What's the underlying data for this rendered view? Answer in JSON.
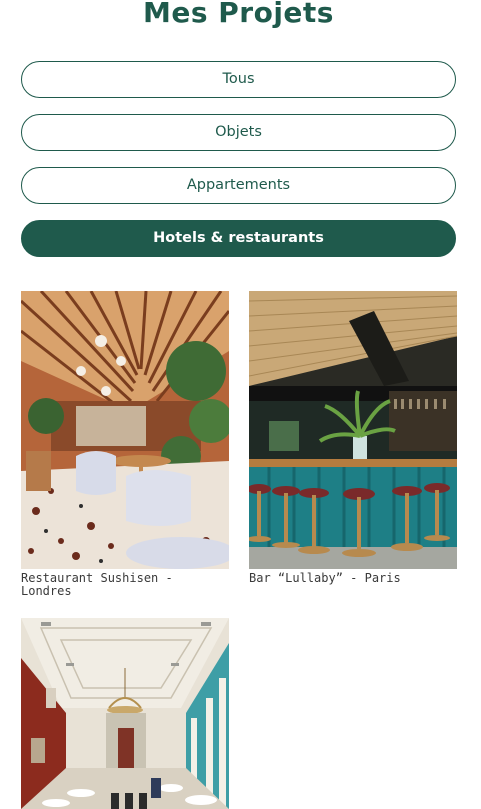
{
  "header": {
    "title": "Mes Projets"
  },
  "filters": [
    {
      "label": "Tous",
      "active": false
    },
    {
      "label": "Objets",
      "active": false
    },
    {
      "label": "Appartements",
      "active": false
    },
    {
      "label": "Hotels & restaurants",
      "active": true
    }
  ],
  "projects": [
    {
      "caption": "Restaurant Sushisen - Londres"
    },
    {
      "caption": "Bar “Lullaby” - Paris"
    },
    {
      "caption": ""
    }
  ],
  "colors": {
    "accent": "#1f5a4c",
    "text": "#3a3a3a",
    "background": "#ffffff"
  }
}
